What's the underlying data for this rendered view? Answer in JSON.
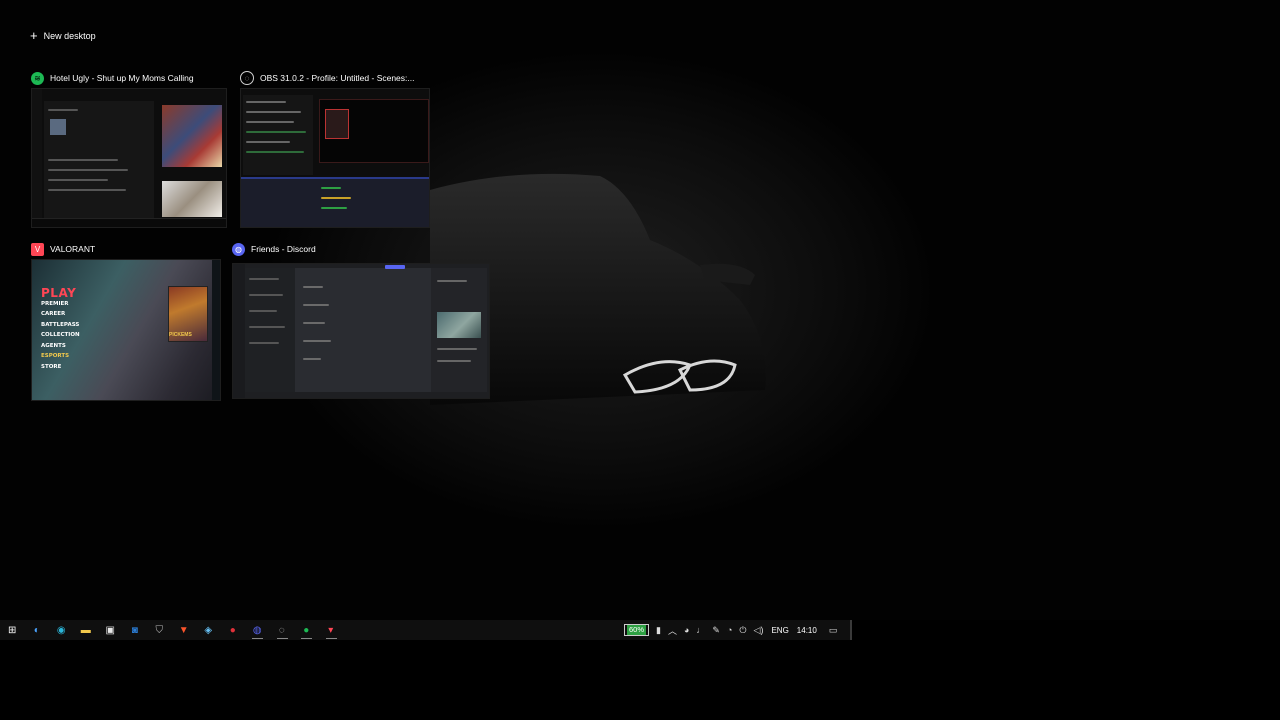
{
  "new_desktop": {
    "label": "New desktop",
    "icon": "plus-icon"
  },
  "windows": [
    {
      "title": "Hotel Ugly - Shut up My Moms Calling",
      "app_icon": "spotify-icon",
      "icon_color": "#1db954"
    },
    {
      "title": "OBS 31.0.2 - Profile: Untitled - Scenes:...",
      "app_icon": "obs-icon",
      "icon_color": "#cfcfcf"
    },
    {
      "title": "VALORANT",
      "app_icon": "valorant-icon",
      "icon_color": "#ff4655"
    },
    {
      "title": "Friends - Discord",
      "app_icon": "discord-icon",
      "icon_color": "#5865f2"
    }
  ],
  "valorant_menu": {
    "play": "PLAY",
    "items": [
      "PREMIER",
      "CAREER",
      "BATTLEPASS",
      "COLLECTION",
      "AGENTS",
      "ESPORTS",
      "STORE"
    ],
    "card_label": "PICKEMS"
  },
  "taskbar": {
    "apps": [
      {
        "name": "start-icon",
        "glyph": "⊞",
        "color": "#ffffff",
        "running": false
      },
      {
        "name": "copilot-icon",
        "glyph": "◐",
        "color": "#4aa3ff",
        "running": false
      },
      {
        "name": "edge-icon",
        "glyph": "◉",
        "color": "#2bb5d8",
        "running": false
      },
      {
        "name": "file-explorer-icon",
        "glyph": "▬",
        "color": "#f2c94c",
        "running": false
      },
      {
        "name": "store-icon",
        "glyph": "▣",
        "color": "#e8e8e8",
        "running": false
      },
      {
        "name": "outlook-icon",
        "glyph": "◙",
        "color": "#2b7cd3",
        "running": false
      },
      {
        "name": "security-icon",
        "glyph": "⛉",
        "color": "#bbbbbb",
        "running": false
      },
      {
        "name": "brave-icon",
        "glyph": "▼",
        "color": "#fb542b",
        "running": false
      },
      {
        "name": "steam-icon",
        "glyph": "◈",
        "color": "#66c0f4",
        "running": false
      },
      {
        "name": "app-red-icon",
        "glyph": "●",
        "color": "#e0313a",
        "running": false
      },
      {
        "name": "discord-icon",
        "glyph": "◍",
        "color": "#5865f2",
        "running": true
      },
      {
        "name": "obs-icon",
        "glyph": "◌",
        "color": "#cccccc",
        "running": true
      },
      {
        "name": "spotify-icon",
        "glyph": "●",
        "color": "#1db954",
        "running": true
      },
      {
        "name": "valorant-icon",
        "glyph": "▾",
        "color": "#ff4655",
        "running": true
      }
    ],
    "tray": {
      "battery_percent": "60%",
      "icons": [
        "battery-saver-icon",
        "chevron-up-icon",
        "controller-icon",
        "microphone-icon",
        "pen-icon",
        "wifi-icon",
        "power-icon",
        "volume-icon"
      ],
      "language": "ENG",
      "time": "14:10",
      "notification_icon": "notification-icon"
    }
  }
}
